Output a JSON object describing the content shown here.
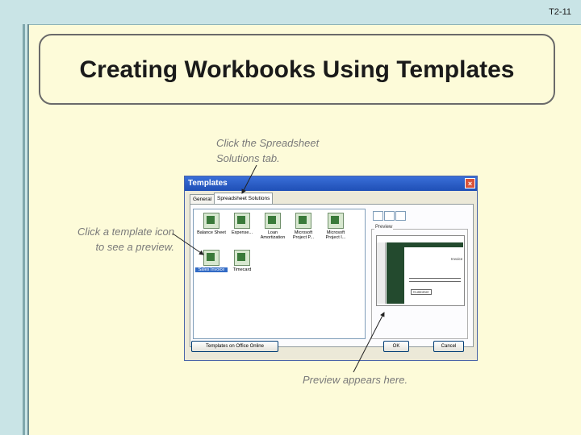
{
  "slide": {
    "number": "T2-11",
    "title": "Creating Workbooks Using Templates"
  },
  "callouts": {
    "tab": [
      "Click the Spreadsheet",
      "Solutions tab."
    ],
    "icon": [
      "Click a template icon",
      "to see a preview."
    ],
    "preview": "Preview appears here."
  },
  "dialog": {
    "title": "Templates",
    "close": "×",
    "tabs": [
      "General",
      "Spreadsheet Solutions"
    ],
    "templates": [
      {
        "label": "Balance Sheet"
      },
      {
        "label": "Expense..."
      },
      {
        "label": "Loan Amortization"
      },
      {
        "label": "Microsoft Project P..."
      },
      {
        "label": "Microsoft Project I..."
      },
      {
        "label": "Sales Invoice"
      },
      {
        "label": "Timecard"
      }
    ],
    "preview_label": "Preview",
    "preview_text": {
      "invoice": "Invoice",
      "customer": "Customer"
    },
    "buttons": {
      "online": "Templates on Office Online",
      "ok": "OK",
      "cancel": "Cancel"
    }
  },
  "colors": {
    "background": "#fdfbd9",
    "frame": "#c9e4e6",
    "titlebar": "#1f4fb6",
    "selection": "#316ac5"
  }
}
